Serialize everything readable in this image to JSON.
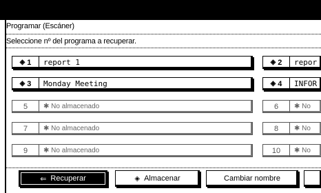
{
  "screen": {
    "title": "Programar (Escáner)",
    "instruction": "Seleccione nº del programa a recuperar."
  },
  "programs": {
    "left": [
      {
        "number": "1",
        "name": "report 1",
        "stored": true
      },
      {
        "number": "3",
        "name": "Monday Meeting",
        "stored": true
      },
      {
        "number": "5",
        "name": "✱ No almacenado",
        "stored": false
      },
      {
        "number": "7",
        "name": "✱ No almacenado",
        "stored": false
      },
      {
        "number": "9",
        "name": "✱ No almacenado",
        "stored": false
      }
    ],
    "right": [
      {
        "number": "2",
        "name": "repor",
        "stored": true
      },
      {
        "number": "4",
        "name": "INFOR",
        "stored": true
      },
      {
        "number": "6",
        "name": "✱ No",
        "stored": false
      },
      {
        "number": "8",
        "name": "✱ No",
        "stored": false
      },
      {
        "number": "10",
        "name": "✱ No",
        "stored": false
      }
    ],
    "stored_icon": "◈"
  },
  "actions": {
    "recall": "Recuperar",
    "recall_icon": "⇐",
    "store": "Almacenar",
    "store_icon": "◈",
    "rename": "Cambiar nombre"
  }
}
